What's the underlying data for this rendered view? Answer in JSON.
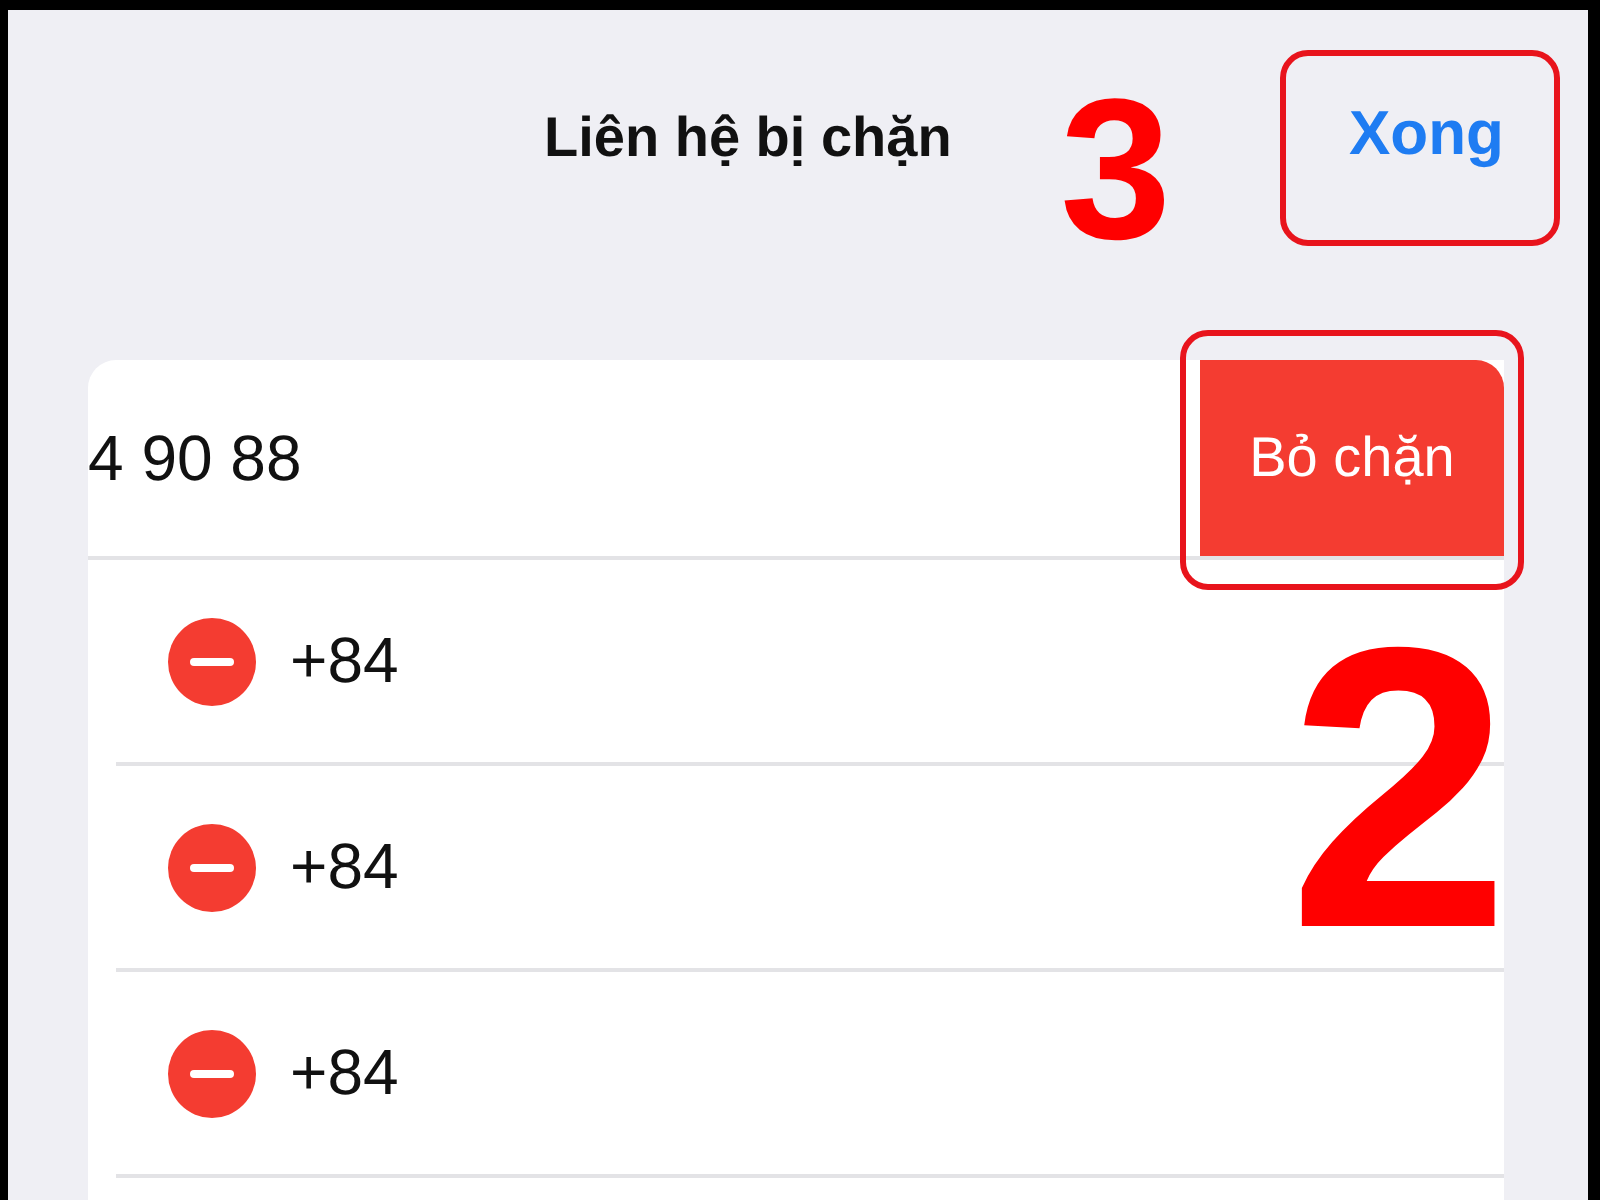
{
  "nav_bar": {
    "title": "Liên hệ bị chặn",
    "done_button": "Xong"
  },
  "contacts": [
    {
      "kind": "swiped",
      "number": "4 90 88",
      "action": "Bỏ chặn"
    },
    {
      "kind": "editing",
      "number": "+84"
    },
    {
      "kind": "editing",
      "number": "+84"
    },
    {
      "kind": "editing",
      "number": "+84"
    }
  ],
  "callouts": [
    {
      "text": "3"
    },
    {
      "text": "2"
    }
  ]
}
